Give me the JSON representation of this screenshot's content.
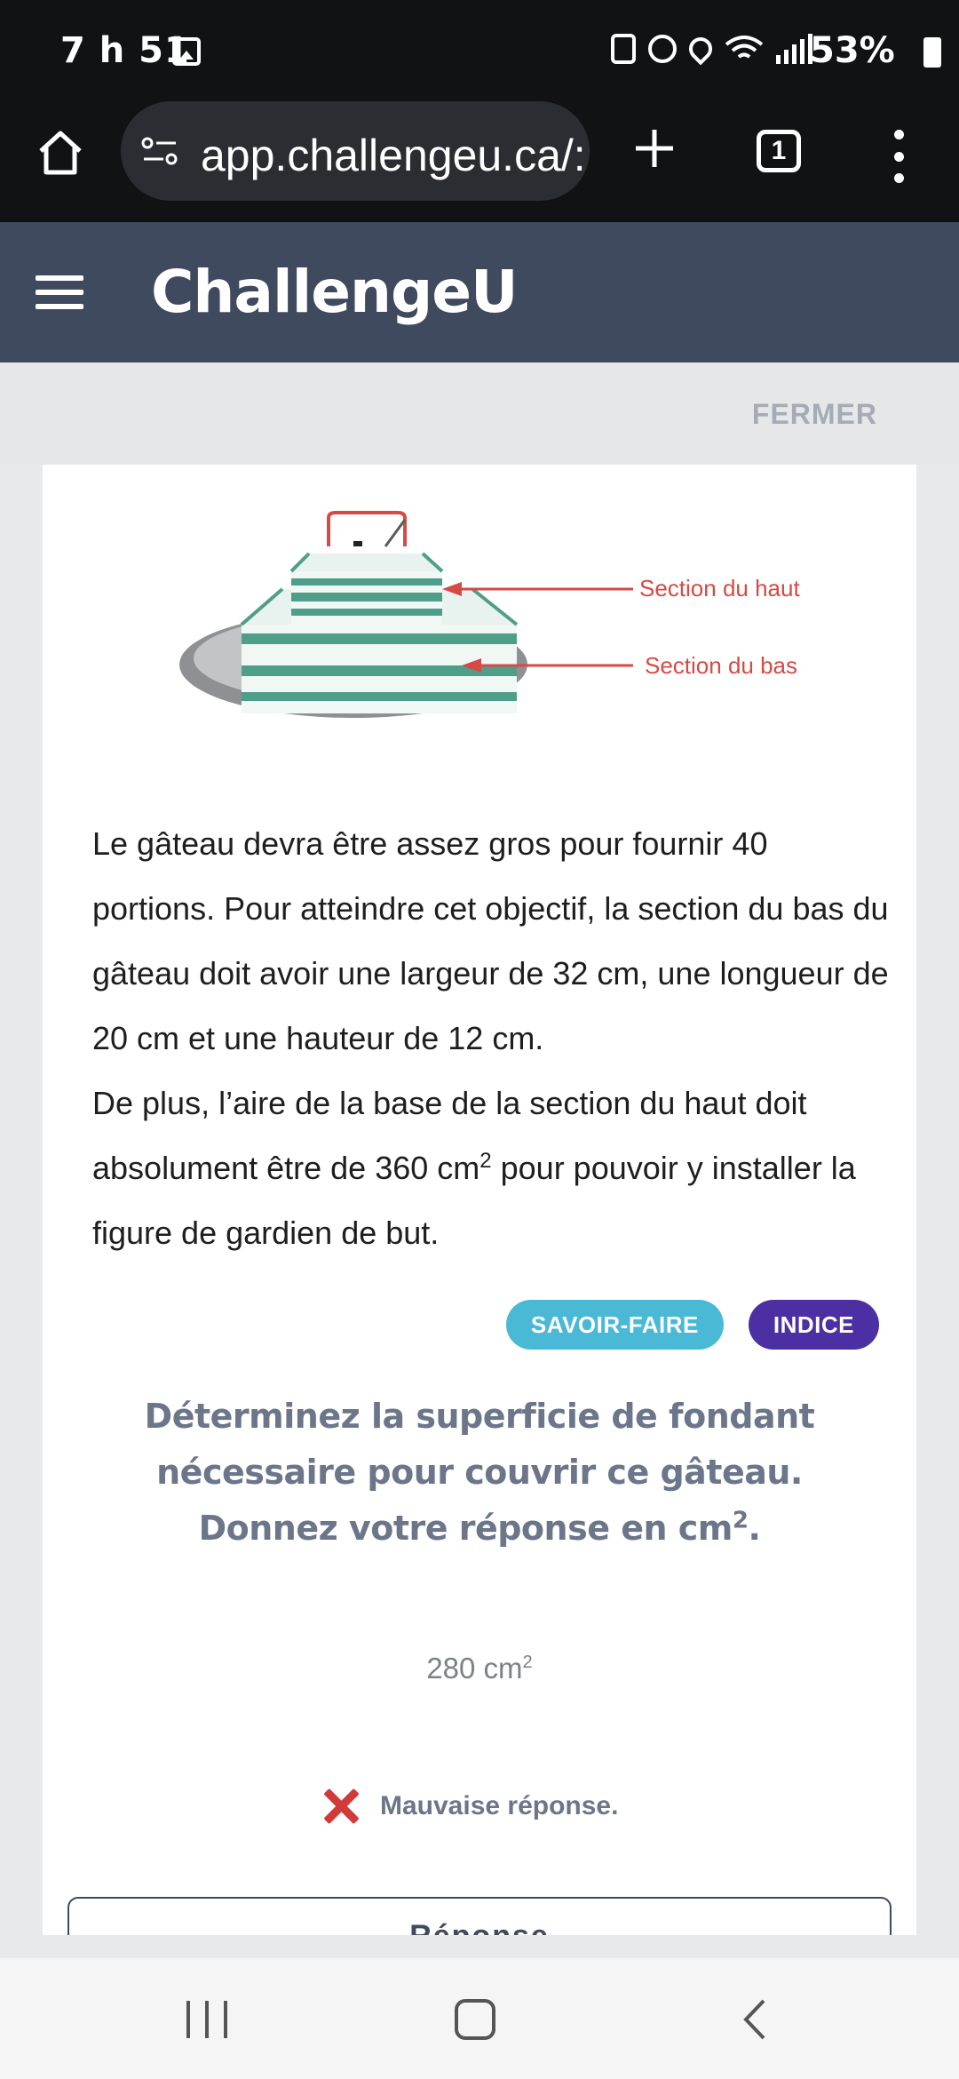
{
  "status_bar": {
    "time": "7 h 51",
    "battery": "53%"
  },
  "browser": {
    "url": "app.challengeu.ca/:",
    "tab_count": "1"
  },
  "app": {
    "title": "ChallengeU",
    "close_label": "FERMER"
  },
  "diagram": {
    "top_label": "Section du haut",
    "bottom_label": "Section du bas"
  },
  "problem": {
    "p1": "Le gâteau devra être assez gros pour fournir 40 portions. Pour atteindre cet objectif, la section du bas du gâteau doit avoir une largeur de 32 cm, une longueur de 20 cm et une hauteur de 12 cm.",
    "p2_before": "De plus, l’aire de la base de la section du haut doit absolument être de 360 cm",
    "p2_sup": "2",
    "p2_after": " pour pouvoir y installer la figure de gardien de but."
  },
  "tags": {
    "skill": "SAVOIR-FAIRE",
    "hint": "INDICE"
  },
  "question": {
    "text": "Déterminez la superficie de fondant nécessaire pour couvrir ce gâteau. Donnez votre réponse en cm",
    "sup": "2",
    "end": "."
  },
  "answer": {
    "value": "280 cm",
    "sup": "2"
  },
  "feedback": {
    "text": "Mauvaise réponse."
  },
  "answer_button": {
    "label": "Réponse"
  }
}
